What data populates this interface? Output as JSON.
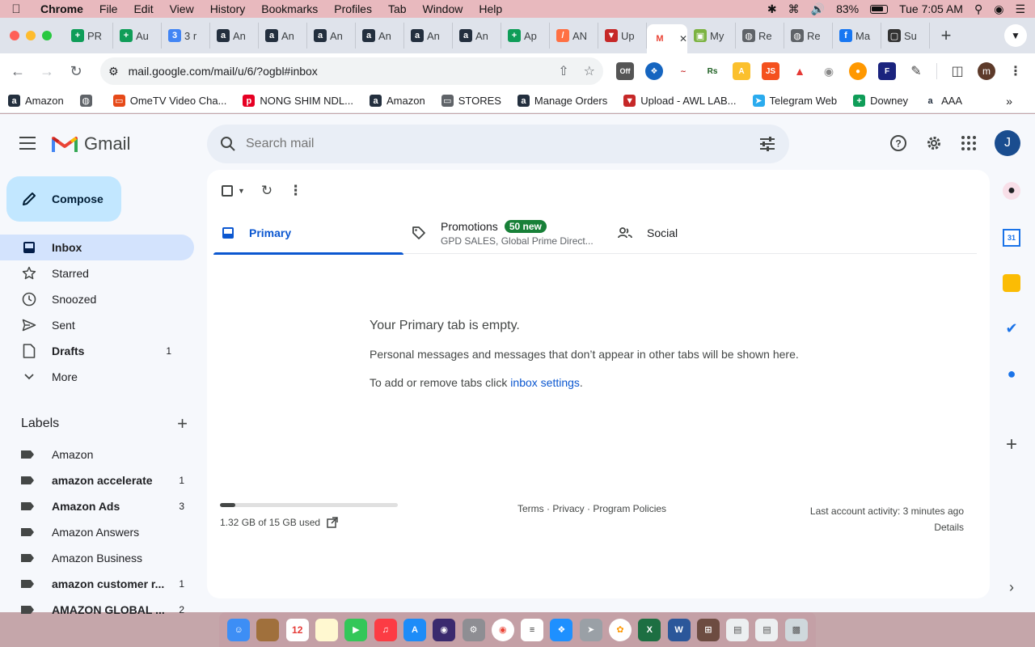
{
  "menubar": {
    "app": "Chrome",
    "items": [
      "File",
      "Edit",
      "View",
      "History",
      "Bookmarks",
      "Profiles",
      "Tab",
      "Window",
      "Help"
    ],
    "battery": "83%",
    "clock": "Tue 7:05 AM"
  },
  "tabs": [
    {
      "label": "PR",
      "icon": "sheets-icon",
      "color": "#0f9d58",
      "glyph": "+"
    },
    {
      "label": "Au",
      "icon": "sheets-icon",
      "color": "#0f9d58",
      "glyph": "+"
    },
    {
      "label": "3 r",
      "icon": "number-icon",
      "color": "#4285f4",
      "glyph": "3"
    },
    {
      "label": "An",
      "icon": "amazon-icon",
      "color": "#232f3e",
      "glyph": "a"
    },
    {
      "label": "An",
      "icon": "amazon-icon",
      "color": "#232f3e",
      "glyph": "a"
    },
    {
      "label": "An",
      "icon": "amazon-icon",
      "color": "#232f3e",
      "glyph": "a"
    },
    {
      "label": "An",
      "icon": "amazon-icon",
      "color": "#232f3e",
      "glyph": "a"
    },
    {
      "label": "An",
      "icon": "amazon-icon",
      "color": "#232f3e",
      "glyph": "a"
    },
    {
      "label": "An",
      "icon": "amazon-icon",
      "color": "#232f3e",
      "glyph": "a"
    },
    {
      "label": "Ap",
      "icon": "sheets-icon",
      "color": "#0f9d58",
      "glyph": "+"
    },
    {
      "label": "AN",
      "icon": "pencil-icon",
      "color": "#ff7043",
      "glyph": "/"
    },
    {
      "label": "Up",
      "icon": "awl-icon",
      "color": "#c62828",
      "glyph": "▼"
    },
    {
      "label": "",
      "icon": "gmail-icon",
      "color": "#ffffff",
      "glyph": "M",
      "active": true
    },
    {
      "label": "My",
      "icon": "image-icon",
      "color": "#7cb342",
      "glyph": "▣"
    },
    {
      "label": "Re",
      "icon": "globe-icon",
      "color": "#5f6368",
      "glyph": "◍"
    },
    {
      "label": "Re",
      "icon": "globe-icon",
      "color": "#5f6368",
      "glyph": "◍"
    },
    {
      "label": "Ma",
      "icon": "facebook-icon",
      "color": "#1877f2",
      "glyph": "f"
    },
    {
      "label": "Su",
      "icon": "square-icon",
      "color": "#333333",
      "glyph": "▢"
    }
  ],
  "toolbar": {
    "url": "mail.google.com/mail/u/6/?ogbl#inbox",
    "off_badge": "Off",
    "ext_rs": "Rs",
    "ext_js": "JS",
    "profile_initial": "m"
  },
  "bookmarks": [
    {
      "label": "Amazon",
      "icon": "amazon-icon",
      "color": "#232f3e",
      "glyph": "a"
    },
    {
      "label": "",
      "icon": "globe-icon",
      "color": "#5f6368",
      "glyph": "◍"
    },
    {
      "label": "OmeTV Video Cha...",
      "icon": "tv-icon",
      "color": "#e64a19",
      "glyph": "▭"
    },
    {
      "label": "NONG SHIM NDL...",
      "icon": "pinterest-icon",
      "color": "#e60023",
      "glyph": "p"
    },
    {
      "label": "Amazon",
      "icon": "amazon-icon",
      "color": "#232f3e",
      "glyph": "a"
    },
    {
      "label": "STORES",
      "icon": "folder-icon",
      "color": "#5f6368",
      "glyph": "▭"
    },
    {
      "label": "Manage Orders",
      "icon": "amazon-icon",
      "color": "#232f3e",
      "glyph": "a"
    },
    {
      "label": "Upload - AWL LAB...",
      "icon": "awl-icon",
      "color": "#c62828",
      "glyph": "▼"
    },
    {
      "label": "Telegram Web",
      "icon": "telegram-icon",
      "color": "#2aabee",
      "glyph": "➤"
    },
    {
      "label": "Downey",
      "icon": "sheets-icon",
      "color": "#0f9d58",
      "glyph": "+"
    },
    {
      "label": "AAA",
      "icon": "amazon-icon",
      "color": "#ffffff",
      "glyph": "a"
    }
  ],
  "gmail": {
    "logo_text": "Gmail",
    "search_placeholder": "Search mail",
    "avatar_initial": "J",
    "compose_label": "Compose",
    "nav": [
      {
        "label": "Inbox",
        "icon": "inbox-icon",
        "active": true,
        "bold": true,
        "count": ""
      },
      {
        "label": "Starred",
        "icon": "star-icon",
        "count": ""
      },
      {
        "label": "Snoozed",
        "icon": "clock-icon",
        "count": ""
      },
      {
        "label": "Sent",
        "icon": "send-icon",
        "count": ""
      },
      {
        "label": "Drafts",
        "icon": "draft-icon",
        "bold": true,
        "count": "1"
      },
      {
        "label": "More",
        "icon": "chevron-down-icon",
        "count": ""
      }
    ],
    "labels_title": "Labels",
    "labels": [
      {
        "label": "Amazon",
        "count": "",
        "bold": false
      },
      {
        "label": "amazon accelerate",
        "count": "1",
        "bold": true
      },
      {
        "label": "Amazon Ads",
        "count": "3",
        "bold": true
      },
      {
        "label": "Amazon Answers",
        "count": "",
        "bold": false
      },
      {
        "label": "Amazon Business",
        "count": "",
        "bold": false
      },
      {
        "label": "amazon customer r...",
        "count": "1",
        "bold": true
      },
      {
        "label": "AMAZON GLOBAL ...",
        "count": "2",
        "bold": true
      }
    ],
    "tabs": {
      "primary": "Primary",
      "promotions": "Promotions",
      "promotions_badge": "50 new",
      "promotions_sub": "GPD SALES, Global Prime Direct...",
      "social": "Social"
    },
    "empty": {
      "title": "Your Primary tab is empty.",
      "body": "Personal messages and messages that don’t appear in other tabs will be shown here.",
      "settings_prefix": "To add or remove tabs click ",
      "settings_link": "inbox settings",
      "settings_suffix": "."
    },
    "footer": {
      "storage_text": "1.32 GB of 15 GB used",
      "storage_fraction": 0.088,
      "policies": "Terms · Privacy · Program Policies",
      "activity": "Last account activity: 3 minutes ago",
      "details": "Details"
    }
  },
  "colors": {
    "accent": "#0b57d0",
    "compose_bg": "#c2e7ff",
    "active_nav": "#d3e3fd",
    "badge_green": "#188038"
  }
}
